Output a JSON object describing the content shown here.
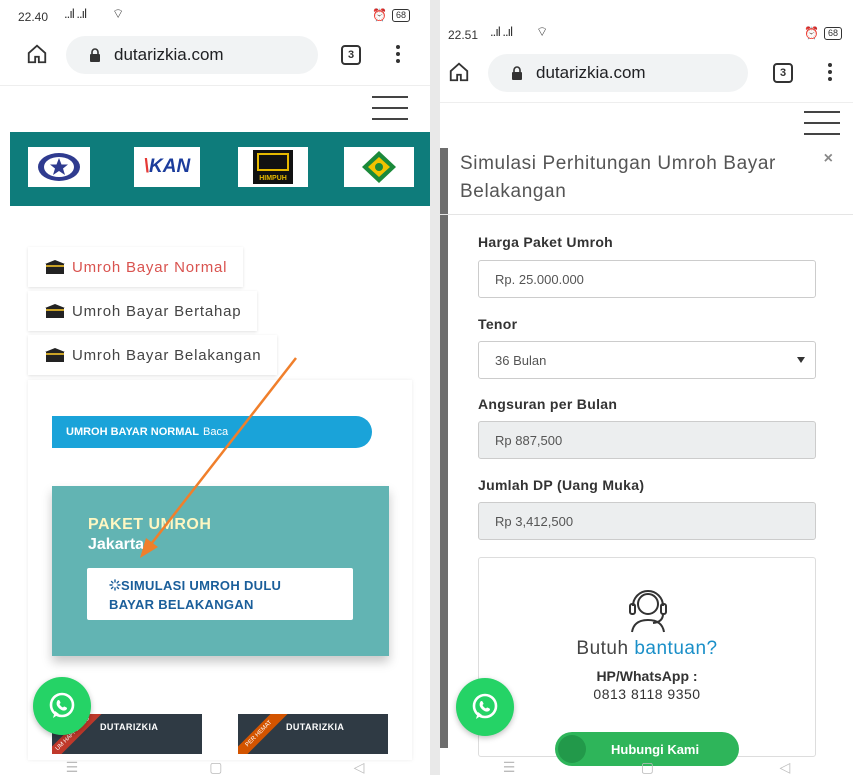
{
  "left": {
    "status": {
      "time": "22.40",
      "signal": "..ıl ..ıl",
      "battery": "68"
    },
    "browser": {
      "url": "dutarizkia.com",
      "tab_count": "3"
    },
    "logos": {
      "kan_text": "KAN",
      "kan_mark": "\\",
      "himpuh_text": "HIMPUH"
    },
    "tabs": [
      {
        "label": "Umroh Bayar Normal",
        "active": true
      },
      {
        "label": "Umroh Bayar Bertahap",
        "active": false
      },
      {
        "label": "Umroh Bayar Belakangan",
        "active": false
      }
    ],
    "pill": {
      "label": "UMROH BAYAR NORMAL",
      "link": "Baca"
    },
    "promo": {
      "line1": "PAKET UMROH",
      "line2": "Jakarta",
      "button_line1": "SIMULASI UMROH DULU",
      "button_line2": "BAYAR BELAKANGAN"
    },
    "thumbs": [
      {
        "brand": "DUTARIZKIA",
        "ribbon": "UM HAPPINESS"
      },
      {
        "brand": "DUTARIZKIA",
        "ribbon": "PER HEMAT"
      }
    ],
    "colors": {
      "accent_red": "#d9534f",
      "teal": "#0e7c7b",
      "blue_pill": "#1aa3d9",
      "whatsapp": "#25d366",
      "arrow": "#f07f2b"
    }
  },
  "right": {
    "status": {
      "time": "22.51",
      "signal": "..ıl ..ıl",
      "battery": "68"
    },
    "browser": {
      "url": "dutarizkia.com",
      "tab_count": "3"
    },
    "modal": {
      "title": "Simulasi Perhitungan Umroh Bayar Belakangan",
      "close": "×"
    },
    "form": {
      "harga_label": "Harga Paket Umroh",
      "harga_value": "Rp. 25.000.000",
      "tenor_label": "Tenor",
      "tenor_value": "36 Bulan",
      "angsuran_label": "Angsuran per Bulan",
      "angsuran_value": "Rp 887,500",
      "dp_label": "Jumlah DP (Uang Muka)",
      "dp_value": "Rp 3,412,500"
    },
    "help": {
      "q_prefix": "Butuh",
      "q_accent": "bantuan?",
      "hp_label": "HP/WhatsApp :",
      "hp_number": "0813 8118 9350",
      "cta": "Hubungi Kami"
    }
  }
}
